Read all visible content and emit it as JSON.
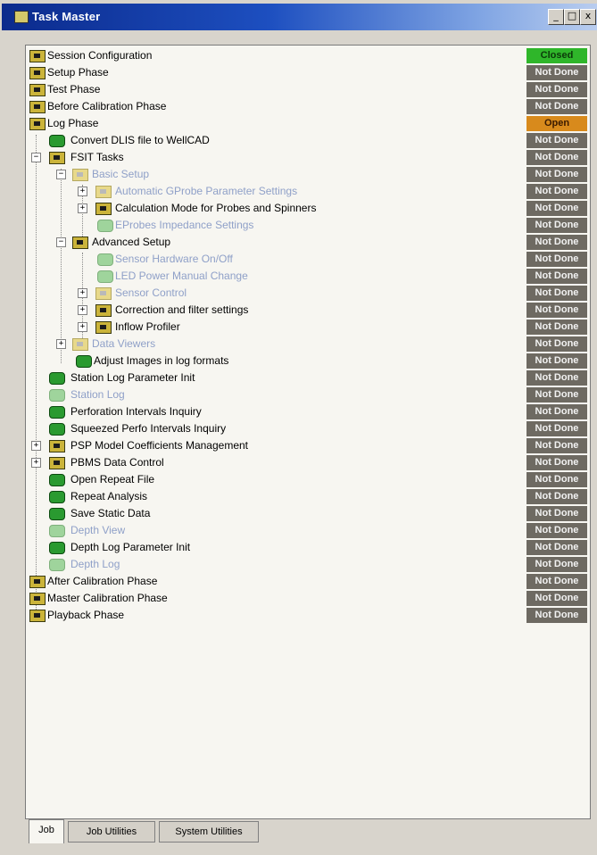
{
  "window": {
    "title": "Task Master",
    "min": "_",
    "max": "□",
    "close": "x"
  },
  "rows": [
    {
      "label": "Session Configuration",
      "status": "Closed",
      "kind": "closed"
    },
    {
      "label": "Setup Phase",
      "status": "Not Done",
      "kind": "nd"
    },
    {
      "label": "Test Phase",
      "status": "Not Done",
      "kind": "nd"
    },
    {
      "label": "Before Calibration Phase",
      "status": "Not Done",
      "kind": "nd"
    },
    {
      "label": "Log Phase",
      "status": "Open",
      "kind": "open"
    },
    {
      "label": "Convert DLIS file to WellCAD",
      "status": "Not Done",
      "kind": "nd"
    },
    {
      "label": "FSIT Tasks",
      "status": "Not Done",
      "kind": "nd"
    },
    {
      "label": "Basic Setup",
      "status": "Not Done",
      "kind": "nd"
    },
    {
      "label": "Automatic GProbe Parameter Settings",
      "status": "Not Done",
      "kind": "nd"
    },
    {
      "label": "Calculation Mode for Probes and Spinners",
      "status": "Not Done",
      "kind": "nd"
    },
    {
      "label": "EProbes Impedance Settings",
      "status": "Not Done",
      "kind": "nd"
    },
    {
      "label": "Advanced Setup",
      "status": "Not Done",
      "kind": "nd"
    },
    {
      "label": "Sensor Hardware On/Off",
      "status": "Not Done",
      "kind": "nd"
    },
    {
      "label": "LED Power Manual Change",
      "status": "Not Done",
      "kind": "nd"
    },
    {
      "label": "Sensor Control",
      "status": "Not Done",
      "kind": "nd"
    },
    {
      "label": "Correction and filter settings",
      "status": "Not Done",
      "kind": "nd"
    },
    {
      "label": "Inflow Profiler",
      "status": "Not Done",
      "kind": "nd"
    },
    {
      "label": "Data Viewers",
      "status": "Not Done",
      "kind": "nd"
    },
    {
      "label": "Adjust Images in log formats",
      "status": "Not Done",
      "kind": "nd"
    },
    {
      "label": "Station Log Parameter Init",
      "status": "Not Done",
      "kind": "nd"
    },
    {
      "label": "Station Log",
      "status": "Not Done",
      "kind": "nd"
    },
    {
      "label": "Perforation Intervals Inquiry",
      "status": "Not Done",
      "kind": "nd"
    },
    {
      "label": "Squeezed Perfo Intervals Inquiry",
      "status": "Not Done",
      "kind": "nd"
    },
    {
      "label": "PSP Model Coefficients Management",
      "status": "Not Done",
      "kind": "nd"
    },
    {
      "label": "PBMS Data Control",
      "status": "Not Done",
      "kind": "nd"
    },
    {
      "label": "Open Repeat File",
      "status": "Not Done",
      "kind": "nd"
    },
    {
      "label": "Repeat Analysis",
      "status": "Not Done",
      "kind": "nd"
    },
    {
      "label": "Save Static Data",
      "status": "Not Done",
      "kind": "nd"
    },
    {
      "label": "Depth View",
      "status": "Not Done",
      "kind": "nd"
    },
    {
      "label": "Depth Log Parameter Init",
      "status": "Not Done",
      "kind": "nd"
    },
    {
      "label": "Depth Log",
      "status": "Not Done",
      "kind": "nd"
    },
    {
      "label": "After Calibration Phase",
      "status": "Not Done",
      "kind": "nd"
    },
    {
      "label": "Master Calibration Phase",
      "status": "Not Done",
      "kind": "nd"
    },
    {
      "label": "Playback Phase",
      "status": "Not Done",
      "kind": "nd"
    }
  ],
  "tabs": [
    "Job",
    "Job Utilities",
    "System Utilities"
  ]
}
